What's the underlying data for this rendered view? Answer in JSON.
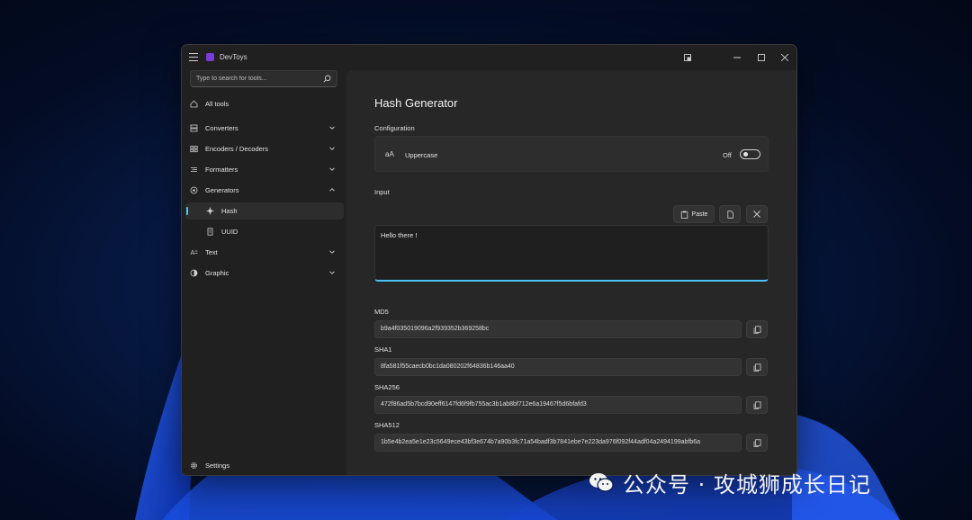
{
  "titlebar": {
    "app_title": "DevToys"
  },
  "sidebar": {
    "search_placeholder": "Type to search for tools...",
    "items": [
      {
        "label": "All tools",
        "icon": "home-icon"
      },
      {
        "label": "Converters",
        "icon": "converters-icon"
      },
      {
        "label": "Encoders / Decoders",
        "icon": "encoders-icon"
      },
      {
        "label": "Formatters",
        "icon": "formatters-icon"
      },
      {
        "label": "Generators",
        "icon": "generators-icon"
      },
      {
        "label": "Hash",
        "icon": "hash-icon"
      },
      {
        "label": "UUID",
        "icon": "uuid-icon"
      },
      {
        "label": "Text",
        "icon": "text-icon"
      },
      {
        "label": "Graphic",
        "icon": "graphic-icon"
      }
    ],
    "settings_label": "Settings"
  },
  "main": {
    "title": "Hash Generator",
    "configuration_label": "Configuration",
    "uppercase_icon_text": "aA",
    "uppercase_label": "Uppercase",
    "uppercase_state": "Off",
    "input_label": "Input",
    "paste_label": "Paste",
    "input_value": "Hello there !",
    "hashes": {
      "md5_label": "MD5",
      "md5_value": "b9a4f035019096a2f939352b369258bc",
      "sha1_label": "SHA1",
      "sha1_value": "8fa581f55caecb0bc1da080202f64836b146aa40",
      "sha256_label": "SHA256",
      "sha256_value": "472f86ad5b7bcd90eff6147fd6f9fb755ac3b1ab8bf712e6a19467f5d6bfafd3",
      "sha512_label": "SHA512",
      "sha512_value": "1b5e4b2ea5e1e23c5649ece43bf3e674b7a90b3fc71a54badf3b7841ebe7e223da976f092f44adf04a2494199abfb6a"
    }
  },
  "watermark": {
    "text": "公众号 · 攻城狮成长日记"
  },
  "colors": {
    "accent": "#4cc2ff",
    "window_bg": "#202020",
    "content_bg": "#272727"
  }
}
